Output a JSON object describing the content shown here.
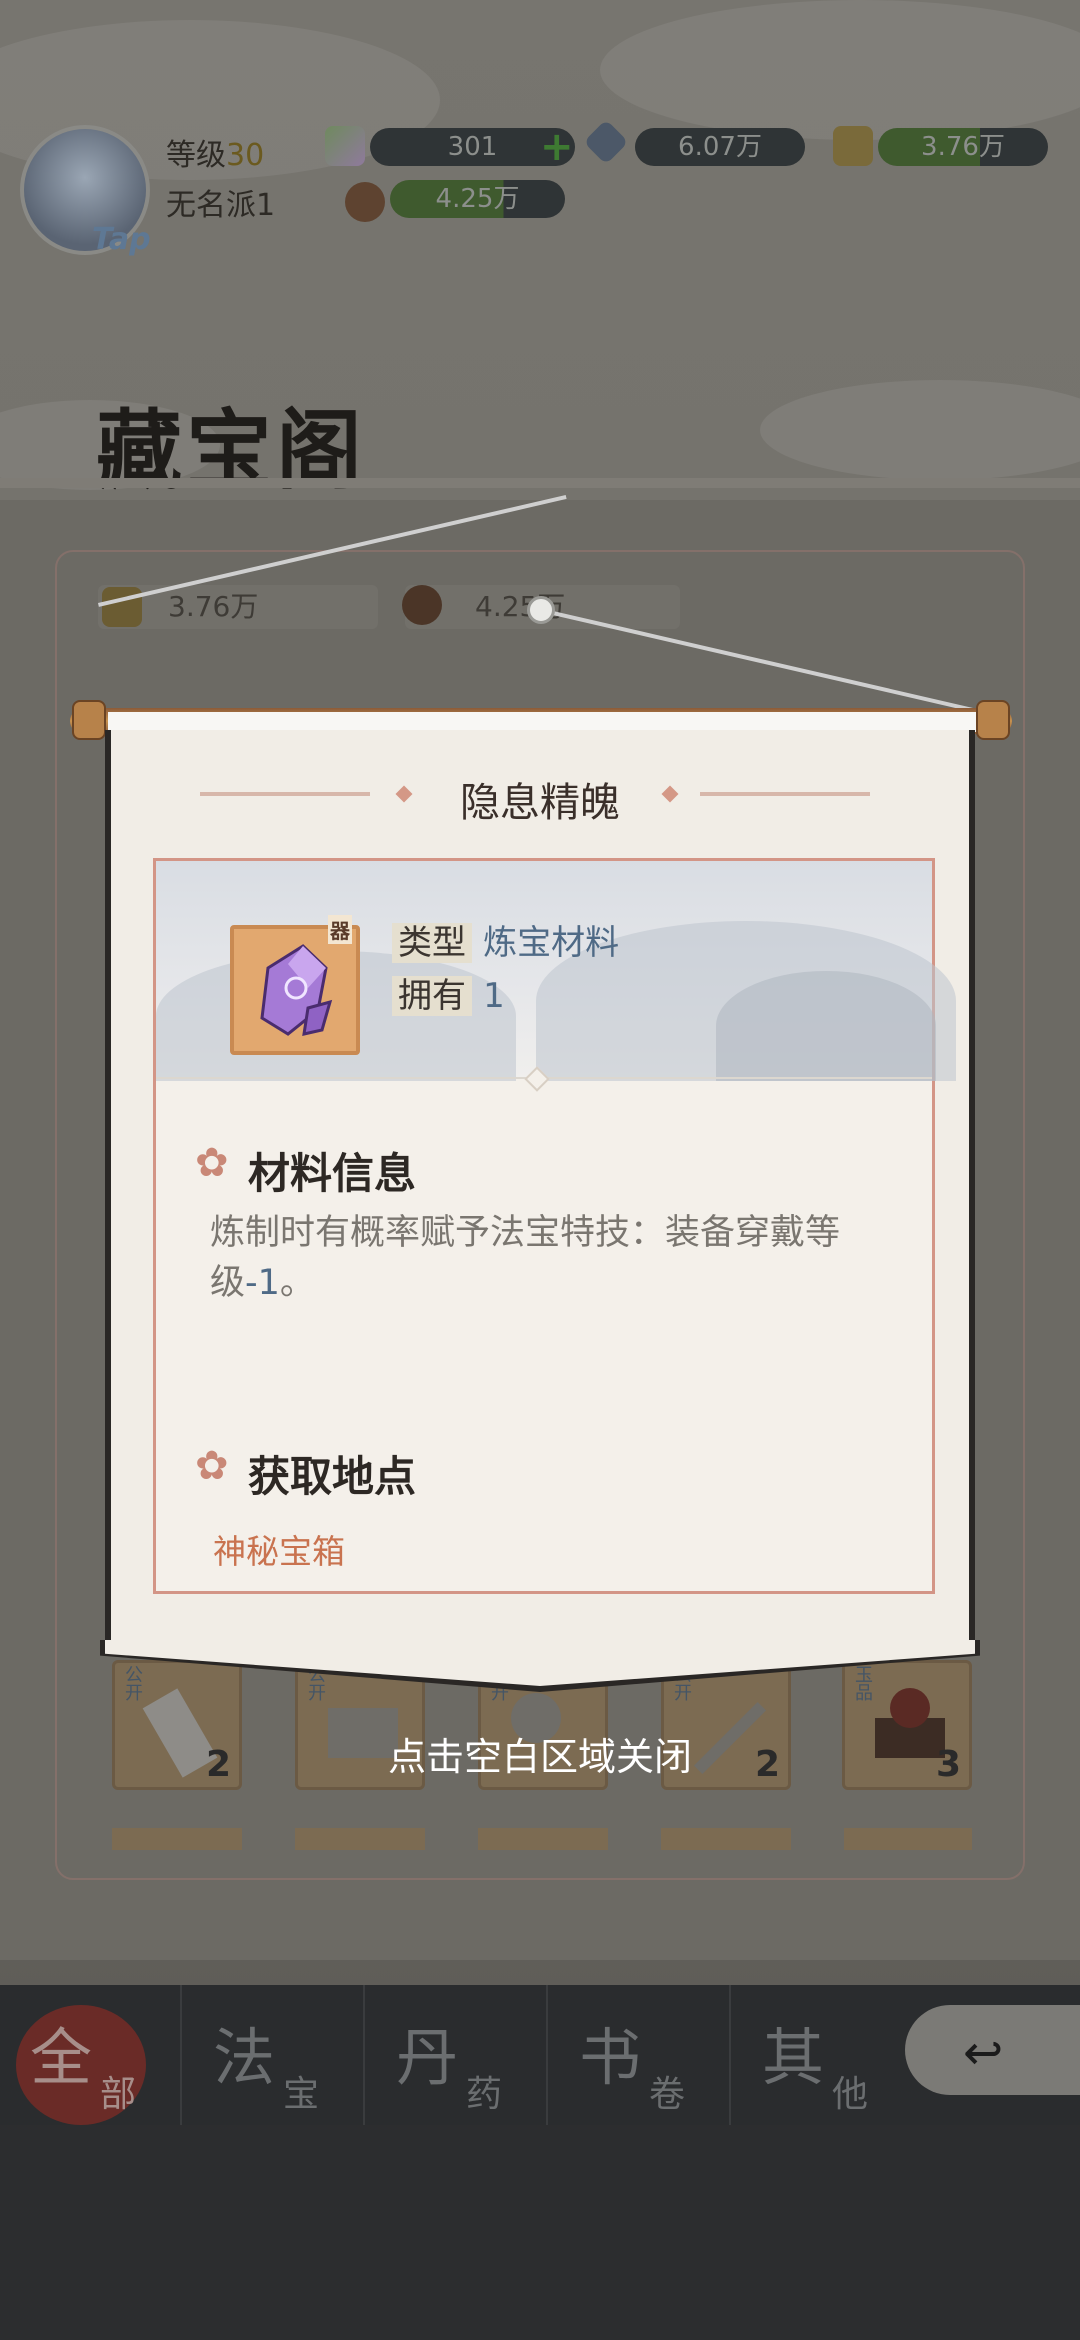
{
  "header": {
    "level_label": "等级",
    "level_value": "30",
    "sect_name": "无名派1",
    "avatar_badge": "Tap",
    "resources": [
      {
        "icon": "jade-crystal-icon",
        "value": "301",
        "has_add": true
      },
      {
        "icon": "spirit-stone-icon",
        "value": "6.07万"
      },
      {
        "icon": "gold-ingot-icon",
        "value": "3.76万"
      },
      {
        "icon": "wood-log-icon",
        "value": "4.25万"
      }
    ]
  },
  "page": {
    "title": "藏宝阁",
    "bg_resources": [
      {
        "icon": "gold-ingot-icon",
        "value": "3.76万"
      },
      {
        "icon": "wood-log-icon",
        "value": "4.25万"
      }
    ],
    "slots": [
      {
        "count": "2",
        "grade": "公开"
      },
      {
        "count": "",
        "grade": "公开"
      },
      {
        "count": "",
        "grade": "公开"
      },
      {
        "count": "2",
        "grade": "公开"
      },
      {
        "count": "3",
        "grade": "玉品"
      }
    ]
  },
  "nav": {
    "tabs": [
      {
        "big": "全",
        "small": "部",
        "active": true
      },
      {
        "big": "法",
        "small": "宝"
      },
      {
        "big": "丹",
        "small": "药"
      },
      {
        "big": "书",
        "small": "卷"
      },
      {
        "big": "其",
        "small": "他"
      }
    ]
  },
  "dialog": {
    "title": "隐息精魄",
    "type_label": "类型",
    "type_value": "炼宝材料",
    "own_label": "拥有",
    "own_value": "1",
    "item_badge": "器",
    "info_title": "材料信息",
    "info_text_1": "炼制时有概率赋予法宝特技：装备穿戴等级",
    "info_text_hl": "-1",
    "info_text_2": "。",
    "source_title": "获取地点",
    "source_value": "神秘宝箱"
  },
  "close_hint": "点击空白区域关闭",
  "colors": {
    "accent_blue": "#4f6a86",
    "source_orange": "#c9734f",
    "card_border": "#d39586"
  }
}
